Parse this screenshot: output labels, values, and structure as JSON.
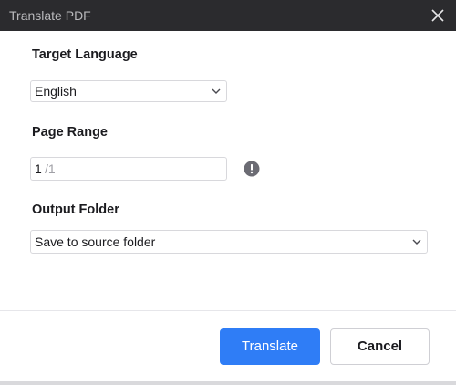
{
  "dialog": {
    "title": "Translate PDF"
  },
  "target_language": {
    "label": "Target Language",
    "selected": "English"
  },
  "page_range": {
    "label": "Page Range",
    "value": "1",
    "total": "/1"
  },
  "output_folder": {
    "label": "Output Folder",
    "selected": "Save to source folder"
  },
  "buttons": {
    "translate": "Translate",
    "cancel": "Cancel"
  },
  "colors": {
    "titlebar": "#2b2b2e",
    "primary": "#2f7df6"
  },
  "icons": {
    "close": "close-icon",
    "chevron": "chevron-down-icon",
    "info": "info-icon"
  }
}
